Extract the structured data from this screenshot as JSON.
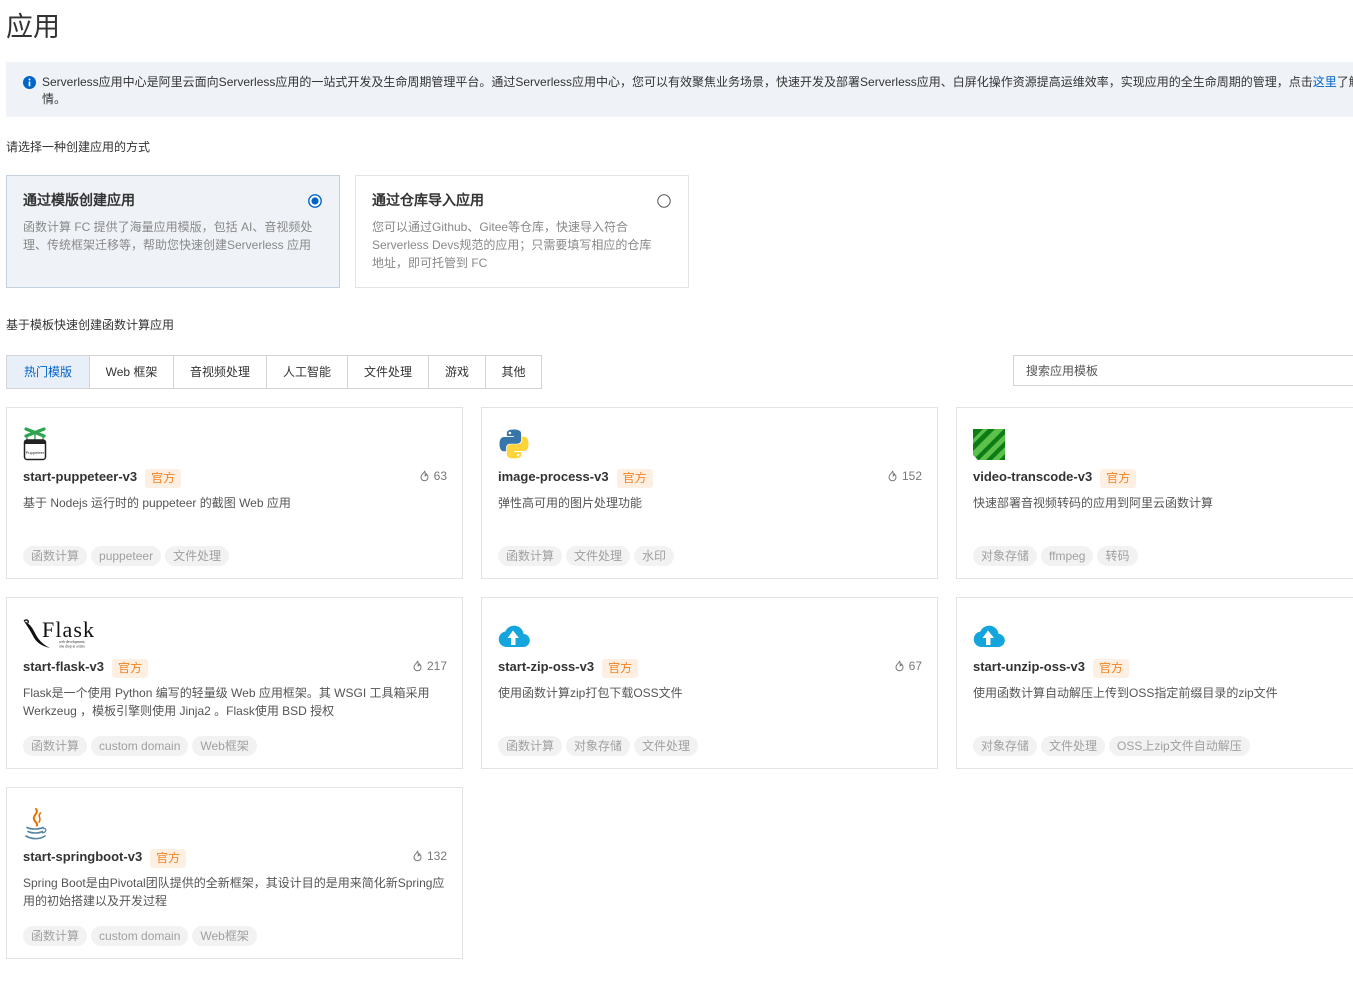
{
  "page": {
    "title": "应用"
  },
  "banner": {
    "icon": "info-icon",
    "text_before_link": "Serverless应用中心是阿里云面向Serverless应用的一站式开发及生命周期管理平台。通过Serverless应用中心，您可以有效聚焦业务场景，快速开发及部署Serverless应用、白屏化操作资源提高运维效率，实现应用的全生命周期的管理，点击",
    "link_text": "这里",
    "text_after_link": "了解更",
    "text_continued": "情。"
  },
  "create_method": {
    "prompt": "请选择一种创建应用的方式",
    "options": [
      {
        "title": "通过模版创建应用",
        "description": "函数计算 FC 提供了海量应用模版，包括 AI、音视频处理、传统框架迁移等，帮助您快速创建Serverless 应用",
        "selected": true
      },
      {
        "title": "通过仓库导入应用",
        "description": "您可以通过Github、Gitee等仓库，快速导入符合Serverless Devs规范的应用；只需要填写相应的仓库地址，即可托管到 FC",
        "selected": false
      }
    ]
  },
  "templates": {
    "heading": "基于模板快速创建函数计算应用",
    "tabs": [
      {
        "label": "热门模版",
        "active": true
      },
      {
        "label": "Web 框架",
        "active": false
      },
      {
        "label": "音视频处理",
        "active": false
      },
      {
        "label": "人工智能",
        "active": false
      },
      {
        "label": "文件处理",
        "active": false
      },
      {
        "label": "游戏",
        "active": false
      },
      {
        "label": "其他",
        "active": false
      }
    ],
    "search": {
      "placeholder": "搜索应用模板",
      "value": ""
    },
    "count_icon": "flame-icon",
    "cards": [
      {
        "icon": "puppeteer-icon",
        "icon_text": "Puppeteer",
        "name": "start-puppeteer-v3",
        "badge": "官方",
        "count": "63",
        "description": "基于 Nodejs 运行时的 puppeteer 的截图 Web 应用",
        "tags": [
          "函数计算",
          "puppeteer",
          "文件处理"
        ]
      },
      {
        "icon": "python-icon",
        "name": "image-process-v3",
        "badge": "官方",
        "count": "152",
        "description": "弹性高可用的图片处理功能",
        "tags": [
          "函数计算",
          "文件处理",
          "水印"
        ]
      },
      {
        "icon": "ffmpeg-icon",
        "name": "video-transcode-v3",
        "badge": "官方",
        "description": "快速部署音视频转码的应用到阿里云函数计算",
        "tags": [
          "对象存储",
          "ffmpeg",
          "转码"
        ]
      },
      {
        "icon": "flask-logo",
        "icon_text": "Flask",
        "icon_tagline": [
          "web development,",
          "one drop at a time"
        ],
        "name": "start-flask-v3",
        "badge": "官方",
        "count": "217",
        "description": "Flask是一个使用 Python 编写的轻量级 Web 应用框架。其 WSGI 工具箱采用 Werkzeug ，模板引擎则使用 Jinja2 。Flask使用 BSD 授权",
        "tags": [
          "函数计算",
          "custom domain",
          "Web框架"
        ]
      },
      {
        "icon": "cloud-upload-icon",
        "name": "start-zip-oss-v3",
        "badge": "官方",
        "count": "67",
        "description": "使用函数计算zip打包下载OSS文件",
        "tags": [
          "函数计算",
          "对象存储",
          "文件处理"
        ]
      },
      {
        "icon": "cloud-upload-icon",
        "name": "start-unzip-oss-v3",
        "badge": "官方",
        "description": "使用函数计算自动解压上传到OSS指定前缀目录的zip文件",
        "tags": [
          "对象存储",
          "文件处理",
          "OSS上zip文件自动解压"
        ]
      },
      {
        "icon": "java-icon",
        "name": "start-springboot-v3",
        "badge": "官方",
        "count": "132",
        "description": "Spring Boot是由Pivotal团队提供的全新框架，其设计目的是用来简化新Spring应用的初始搭建以及开发过程",
        "tags": [
          "函数计算",
          "custom domain",
          "Web框架"
        ]
      }
    ]
  },
  "colors": {
    "accent": "#0064c8",
    "banner_bg": "#eff3f8",
    "selected_card_bg": "#eff3f8",
    "badge_text": "#f5821f",
    "badge_bg": "#fdefe2",
    "tag_text": "#a0a0a0",
    "tag_bg": "#f2f2f2",
    "border": "#e3e3e3"
  }
}
